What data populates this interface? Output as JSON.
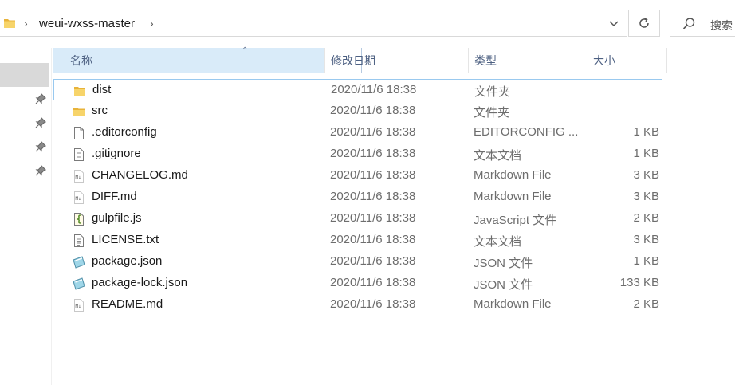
{
  "address": {
    "path": "weui-wxss-master"
  },
  "search": {
    "placeholder": "搜索"
  },
  "columns": {
    "name": "名称",
    "date": "修改日期",
    "type": "类型",
    "size": "大小"
  },
  "files": [
    {
      "icon": "folder-icon",
      "name": "dist",
      "date": "2020/11/6 18:38",
      "type": "文件夹",
      "size": ""
    },
    {
      "icon": "folder-icon",
      "name": "src",
      "date": "2020/11/6 18:38",
      "type": "文件夹",
      "size": ""
    },
    {
      "icon": "blank-file-icon",
      "name": ".editorconfig",
      "date": "2020/11/6 18:38",
      "type": "EDITORCONFIG ...",
      "size": "1 KB"
    },
    {
      "icon": "text-file-icon",
      "name": ".gitignore",
      "date": "2020/11/6 18:38",
      "type": "文本文档",
      "size": "1 KB"
    },
    {
      "icon": "markdown-file-icon",
      "name": "CHANGELOG.md",
      "date": "2020/11/6 18:38",
      "type": "Markdown File",
      "size": "3 KB"
    },
    {
      "icon": "markdown-file-icon",
      "name": "DIFF.md",
      "date": "2020/11/6 18:38",
      "type": "Markdown File",
      "size": "3 KB"
    },
    {
      "icon": "script-file-icon",
      "name": "gulpfile.js",
      "date": "2020/11/6 18:38",
      "type": "JavaScript 文件",
      "size": "2 KB"
    },
    {
      "icon": "text-file-icon",
      "name": "LICENSE.txt",
      "date": "2020/11/6 18:38",
      "type": "文本文档",
      "size": "3 KB"
    },
    {
      "icon": "json-file-icon",
      "name": "package.json",
      "date": "2020/11/6 18:38",
      "type": "JSON 文件",
      "size": "1 KB"
    },
    {
      "icon": "json-file-icon",
      "name": "package-lock.json",
      "date": "2020/11/6 18:38",
      "type": "JSON 文件",
      "size": "133 KB"
    },
    {
      "icon": "markdown-file-icon",
      "name": "README.md",
      "date": "2020/11/6 18:38",
      "type": "Markdown File",
      "size": "2 KB"
    }
  ],
  "colors": {
    "header_selected": "#d9ebf9",
    "focus_border": "#99c9ef",
    "folder": "#f4c542"
  }
}
